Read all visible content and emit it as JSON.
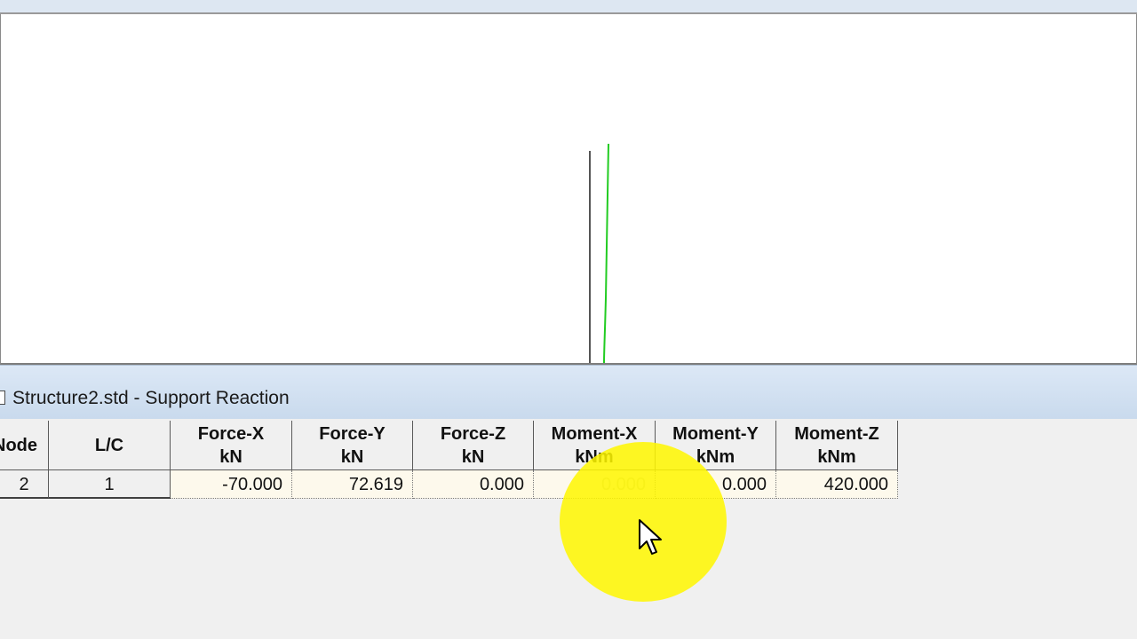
{
  "window": {
    "title": "Structure2.std - Support Reaction"
  },
  "table": {
    "headers": [
      {
        "line1": "Node",
        "line2": ""
      },
      {
        "line1": "L/C",
        "line2": ""
      },
      {
        "line1": "Force-X",
        "line2": "kN"
      },
      {
        "line1": "Force-Y",
        "line2": "kN"
      },
      {
        "line1": "Force-Z",
        "line2": "kN"
      },
      {
        "line1": "Moment-X",
        "line2": "kNm"
      },
      {
        "line1": "Moment-Y",
        "line2": "kNm"
      },
      {
        "line1": "Moment-Z",
        "line2": "kNm"
      }
    ],
    "rows": [
      {
        "node": "2",
        "lc": "1",
        "fx": "-70.000",
        "fy": "72.619",
        "fz": "0.000",
        "mx": "0.000",
        "my": "0.000",
        "mz": "420.000"
      }
    ]
  },
  "colors": {
    "member": "#555555",
    "deflected_shape": "#22cc22",
    "cursor_highlight": "#fff200"
  },
  "icons": {
    "cursor": "arrow-cursor-icon",
    "window": "document-window-icon"
  }
}
